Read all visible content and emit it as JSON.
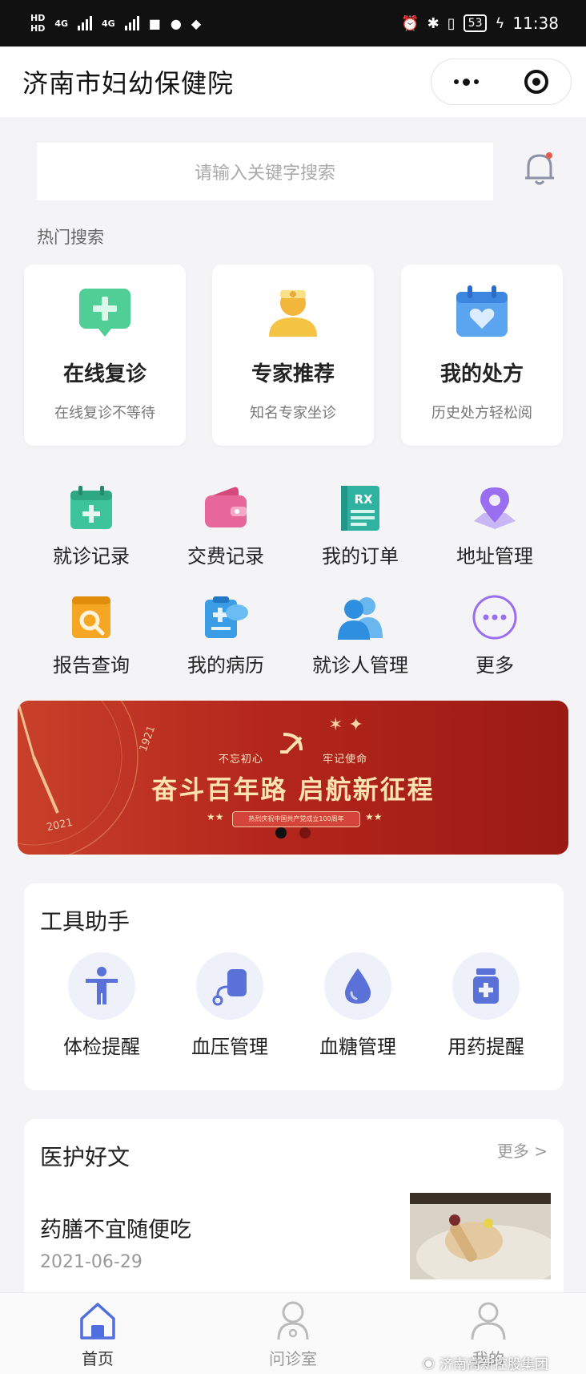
{
  "status_bar": {
    "network_left": "HD",
    "network_right": "HD",
    "signal_1": "4G",
    "signal_2": "4G",
    "battery": "53",
    "time": "11:38"
  },
  "header": {
    "title": "济南市妇幼保健院"
  },
  "search": {
    "placeholder": "请输入关键字搜索"
  },
  "hot": {
    "title": "热门搜索",
    "cards": [
      {
        "title": "在线复诊",
        "subtitle": "在线复诊不等待",
        "icon": "online-revisit-icon"
      },
      {
        "title": "专家推荐",
        "subtitle": "知名专家坐诊",
        "icon": "doctor-icon"
      },
      {
        "title": "我的处方",
        "subtitle": "历史处方轻松阅",
        "icon": "calendar-heart-icon"
      }
    ]
  },
  "menu": [
    {
      "label": "就诊记录",
      "icon": "medical-record-icon"
    },
    {
      "label": "交费记录",
      "icon": "wallet-icon"
    },
    {
      "label": "我的订单",
      "icon": "rx-book-icon"
    },
    {
      "label": "地址管理",
      "icon": "location-pin-icon"
    },
    {
      "label": "报告查询",
      "icon": "report-search-icon"
    },
    {
      "label": "我的病历",
      "icon": "clipboard-icon"
    },
    {
      "label": "就诊人管理",
      "icon": "patients-icon"
    },
    {
      "label": "更多",
      "icon": "more-icon"
    }
  ],
  "banner": {
    "sub_left": "不忘初心",
    "sub_right": "牢记使命",
    "title": "奋斗百年路 启航新征程",
    "pill": "热烈庆祝中国共产党成立100周年",
    "year_a": "2021",
    "year_b": "1921",
    "slide_index": 1,
    "slide_count": 2
  },
  "tools": {
    "title": "工具助手",
    "items": [
      {
        "label": "体检提醒",
        "icon": "body-check-icon"
      },
      {
        "label": "血压管理",
        "icon": "blood-pressure-icon"
      },
      {
        "label": "血糖管理",
        "icon": "blood-drop-icon"
      },
      {
        "label": "用药提醒",
        "icon": "medicine-icon"
      }
    ]
  },
  "articles": {
    "title": "医护好文",
    "more": "更多 >",
    "items": [
      {
        "title": "药膳不宜随便吃",
        "date": "2021-06-29"
      }
    ]
  },
  "tabbar": {
    "items": [
      {
        "label": "首页",
        "icon": "home-icon",
        "active": true
      },
      {
        "label": "问诊室",
        "icon": "consult-icon",
        "active": false
      },
      {
        "label": "我的",
        "icon": "user-icon",
        "active": false
      }
    ]
  },
  "watermark": "济南高新控股集团",
  "colors": {
    "accent": "#4f6ee0",
    "banner_red": "#b4261c",
    "tool_icon": "#5a72d8"
  }
}
